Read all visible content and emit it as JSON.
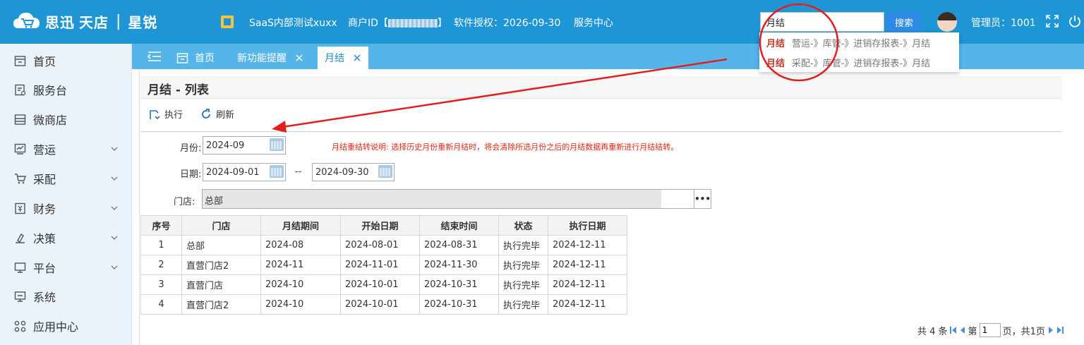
{
  "brand": {
    "name": "思迅",
    "sub": "天店",
    "product": "星锐"
  },
  "header": {
    "company": "SaaS内部测试xuxx",
    "merchant_label": "商户ID【",
    "merchant_close": "】",
    "license": "软件授权：2026-09-30",
    "service": "服务中心",
    "search_value": "月结",
    "search_button": "搜索",
    "admin": "管理员：1001"
  },
  "suggestions": [
    {
      "key": "月结",
      "path": "营运-》库管-》进销存报表-》月结"
    },
    {
      "key": "月结",
      "path": "采配-》库管-》进销存报表-》月结"
    }
  ],
  "sidebar": {
    "items": [
      {
        "label": "首页",
        "icon": "home-icon"
      },
      {
        "label": "服务台",
        "icon": "service-desk-icon"
      },
      {
        "label": "微商店",
        "icon": "shop-icon"
      },
      {
        "label": "营运",
        "icon": "chart-icon"
      },
      {
        "label": "采配",
        "icon": "cart-icon"
      },
      {
        "label": "财务",
        "icon": "finance-icon"
      },
      {
        "label": "决策",
        "icon": "decision-icon"
      },
      {
        "label": "平台",
        "icon": "platform-icon"
      },
      {
        "label": "系统",
        "icon": "system-icon"
      },
      {
        "label": "应用中心",
        "icon": "apps-icon"
      }
    ]
  },
  "tabs": [
    {
      "label": "首页"
    },
    {
      "label": "新功能提醒"
    },
    {
      "label": "月结"
    }
  ],
  "page": {
    "title": "月结 - 列表",
    "execute": "执行",
    "refresh": "刷新",
    "month_label": "月份:",
    "month_value": "2024-09",
    "note": "月结重结转说明: 选择历史月份重新月结时，将会清除所选月份之后的月结数据再重新进行月结结转。",
    "date_label": "日期:",
    "date_from": "2024-09-01",
    "date_sep": "--",
    "date_to": "2024-09-30",
    "store_label": "门店:",
    "store_value": "总部",
    "store_btn": "•••"
  },
  "table": {
    "headers": [
      "序号",
      "门店",
      "月结期间",
      "开始日期",
      "结束时间",
      "状态",
      "执行日期"
    ],
    "rows": [
      [
        "1",
        "总部",
        "2024-08",
        "2024-08-01",
        "2024-08-31",
        "执行完毕",
        "2024-12-11"
      ],
      [
        "2",
        "直营门店2",
        "2024-11",
        "2024-11-01",
        "2024-11-30",
        "执行完毕",
        "2024-12-11"
      ],
      [
        "3",
        "直营门店",
        "2024-10",
        "2024-10-01",
        "2024-10-31",
        "执行完毕",
        "2024-12-11"
      ],
      [
        "4",
        "直营门店2",
        "2024-10",
        "2024-10-01",
        "2024-10-31",
        "执行完毕",
        "2024-12-11"
      ]
    ]
  },
  "pager": {
    "total": "共 4 条",
    "page_prefix": "第",
    "page_value": "1",
    "page_suffix": "页，共1页"
  },
  "colors": {
    "header": "#1e95d4",
    "tabbar": "#55b5e8",
    "accent_red": "#e0261a"
  }
}
